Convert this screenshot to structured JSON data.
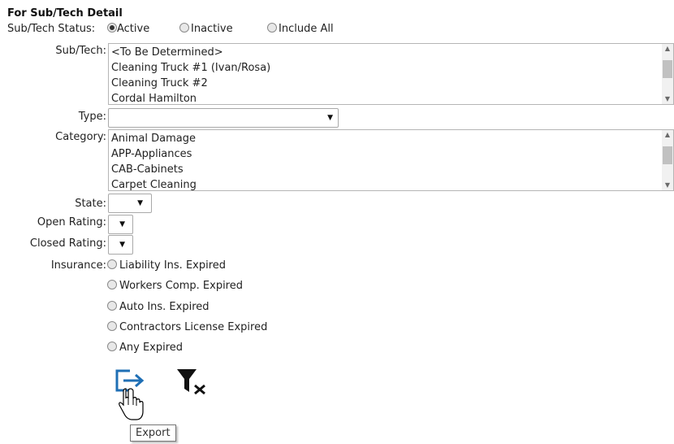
{
  "section": {
    "title": "For Sub/Tech Detail"
  },
  "status": {
    "label": "Sub/Tech Status:",
    "options": [
      {
        "label": "Active",
        "checked": true
      },
      {
        "label": "Inactive",
        "checked": false
      },
      {
        "label": "Include All",
        "checked": false
      }
    ]
  },
  "subtech": {
    "label": "Sub/Tech:",
    "items": [
      "<To Be Determined>",
      "Cleaning Truck #1 (Ivan/Rosa)",
      "Cleaning Truck #2",
      "Cordal Hamilton"
    ]
  },
  "type": {
    "label": "Type:",
    "value": ""
  },
  "category": {
    "label": "Category:",
    "items": [
      "Animal Damage",
      "APP-Appliances",
      "CAB-Cabinets",
      "Carpet Cleaning"
    ]
  },
  "state": {
    "label": "State:",
    "value": ""
  },
  "open_rating": {
    "label": "Open Rating:",
    "value": ""
  },
  "closed_rating": {
    "label": "Closed Rating:",
    "value": ""
  },
  "insurance": {
    "label": "Insurance:",
    "options": [
      {
        "label": "Liability Ins. Expired"
      },
      {
        "label": "Workers Comp. Expired"
      },
      {
        "label": "Auto Ins. Expired"
      },
      {
        "label": "Contractors License Expired"
      },
      {
        "label": "Any Expired"
      }
    ]
  },
  "actions": {
    "export_tooltip": "Export"
  },
  "icons": {
    "export": "export-icon",
    "clear_filter": "clear-filter-icon",
    "cursor": "hand-pointer-icon"
  },
  "colors": {
    "export_icon": "#1f6fb5",
    "filter_icon": "#111111"
  }
}
